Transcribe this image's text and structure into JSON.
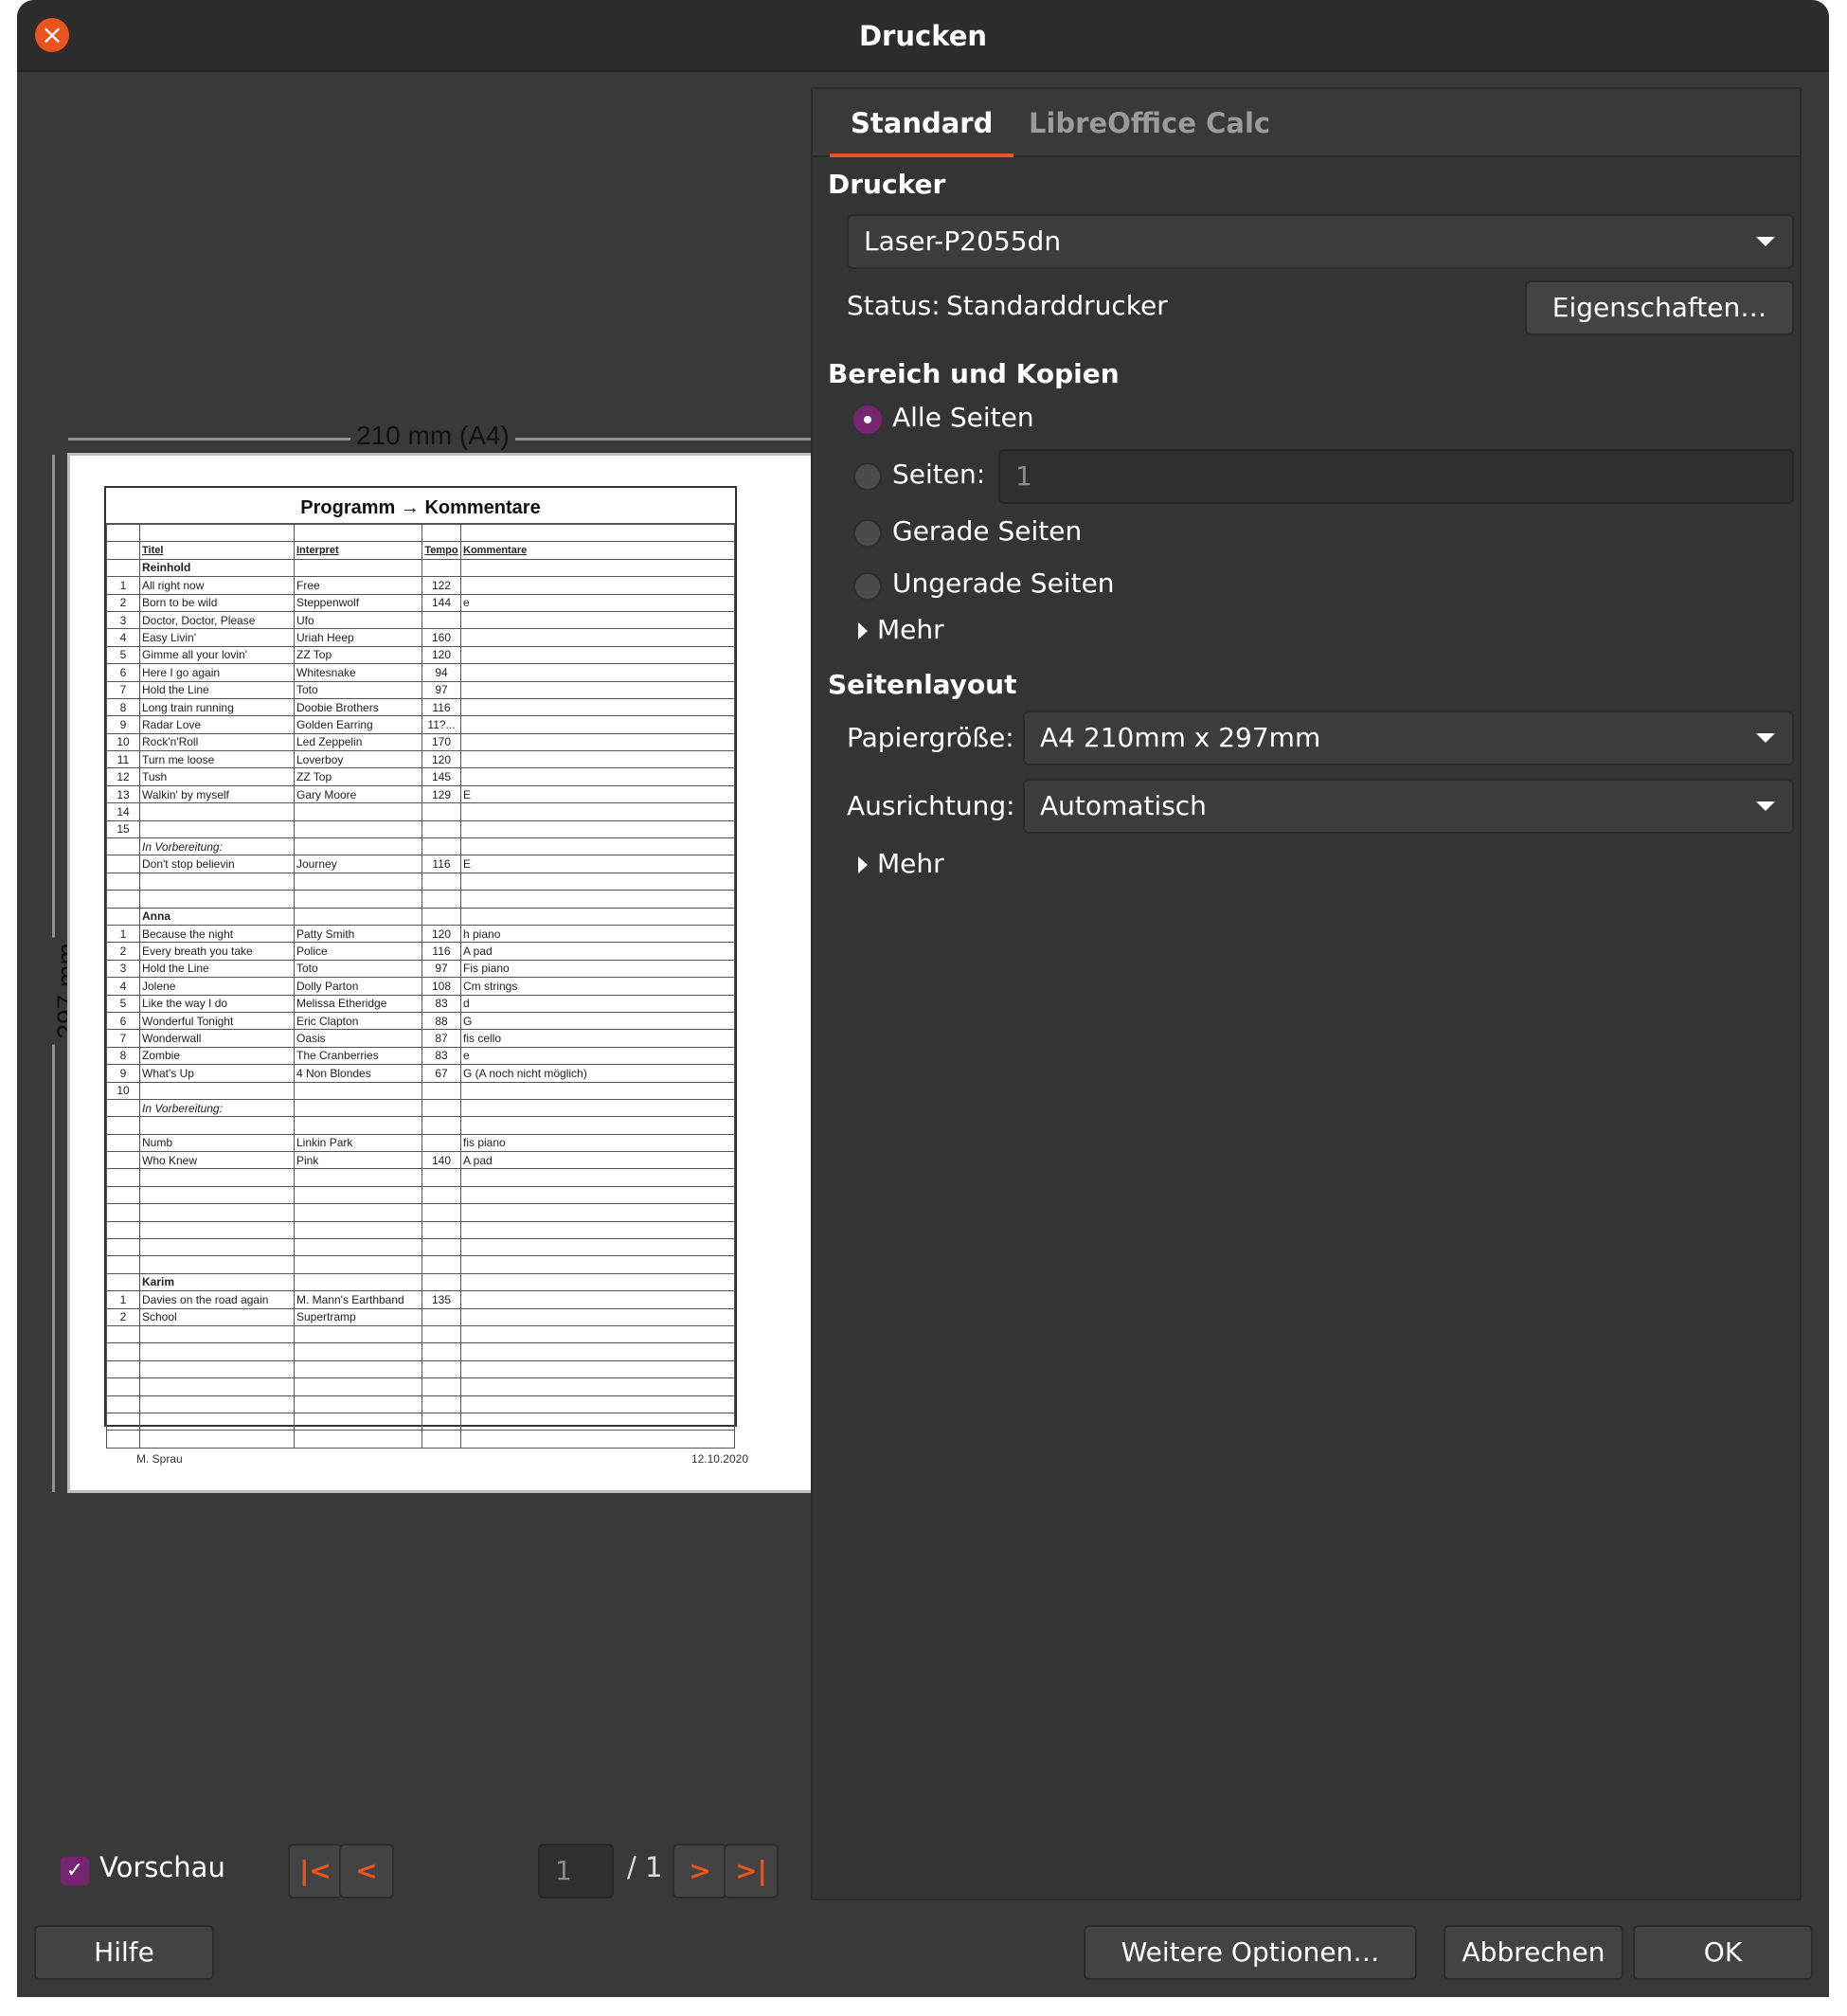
{
  "window": {
    "title": "Drucken"
  },
  "preview": {
    "ruler_width_label": "210 mm (A4)",
    "ruler_height_label": "297 mm",
    "sheet_title": "Programm → Kommentare",
    "footer_left": "M. Sprau",
    "footer_right": "12.10.2020",
    "rows": [
      [
        "",
        "",
        "",
        "",
        ""
      ],
      [
        "",
        "Titel",
        "Interpret",
        "Tempo",
        "Kommentare"
      ],
      [
        "",
        "Reinhold",
        "",
        "",
        ""
      ],
      [
        "1",
        "All right now",
        "Free",
        "122",
        ""
      ],
      [
        "2",
        "Born to be wild",
        "Steppenwolf",
        "144",
        "e"
      ],
      [
        "3",
        "Doctor, Doctor, Please",
        "Ufo",
        "",
        ""
      ],
      [
        "4",
        "Easy Livin'",
        "Uriah Heep",
        "160",
        ""
      ],
      [
        "5",
        "Gimme all your lovin'",
        "ZZ Top",
        "120",
        ""
      ],
      [
        "6",
        "Here I go again",
        "Whitesnake",
        "94",
        ""
      ],
      [
        "7",
        "Hold the Line",
        "Toto",
        "97",
        ""
      ],
      [
        "8",
        "Long train running",
        "Doobie Brothers",
        "116",
        ""
      ],
      [
        "9",
        "Radar Love",
        "Golden Earring",
        "11?...",
        ""
      ],
      [
        "10",
        "Rock'n'Roll",
        "Led Zeppelin",
        "170",
        ""
      ],
      [
        "11",
        "Turn me loose",
        "Loverboy",
        "120",
        ""
      ],
      [
        "12",
        "Tush",
        "ZZ Top",
        "145",
        ""
      ],
      [
        "13",
        "Walkin' by myself",
        "Gary Moore",
        "129",
        "E"
      ],
      [
        "14",
        "",
        "",
        "",
        ""
      ],
      [
        "15",
        "",
        "",
        "",
        ""
      ],
      [
        "",
        "In Vorbereitung:",
        "",
        "",
        ""
      ],
      [
        "",
        "Don't stop believin",
        "Journey",
        "116",
        "E"
      ],
      [
        "",
        "",
        "",
        "",
        ""
      ],
      [
        "",
        "",
        "",
        "",
        ""
      ],
      [
        "",
        "Anna",
        "",
        "",
        ""
      ],
      [
        "1",
        "Because the night",
        "Patty Smith",
        "120",
        "h piano"
      ],
      [
        "2",
        "Every breath you take",
        "Police",
        "116",
        "A pad"
      ],
      [
        "3",
        "Hold the Line",
        "Toto",
        "97",
        "Fis piano"
      ],
      [
        "4",
        "Jolene",
        "Dolly Parton",
        "108",
        "Cm strings"
      ],
      [
        "5",
        "Like the way I do",
        "Melissa Etheridge",
        "83",
        "d"
      ],
      [
        "6",
        "Wonderful Tonight",
        "Eric Clapton",
        "88",
        "G"
      ],
      [
        "7",
        "Wonderwall",
        "Oasis",
        "87",
        "fis cello"
      ],
      [
        "8",
        "Zombie",
        "The Cranberries",
        "83",
        "e"
      ],
      [
        "9",
        "What's Up",
        "4 Non Blondes",
        "67",
        "G (A noch nicht möglich)"
      ],
      [
        "10",
        "",
        "",
        "",
        ""
      ],
      [
        "",
        "In Vorbereitung:",
        "",
        "",
        ""
      ],
      [
        "",
        "",
        "",
        "",
        ""
      ],
      [
        "",
        "Numb",
        "Linkin Park",
        "",
        "fis piano"
      ],
      [
        "",
        "Who Knew",
        "Pink",
        "140",
        "A pad"
      ],
      [
        "",
        "",
        "",
        "",
        ""
      ],
      [
        "",
        "",
        "",
        "",
        ""
      ],
      [
        "",
        "",
        "",
        "",
        ""
      ],
      [
        "",
        "",
        "",
        "",
        ""
      ],
      [
        "",
        "",
        "",
        "",
        ""
      ],
      [
        "",
        "",
        "",
        "",
        ""
      ],
      [
        "",
        "Karim",
        "",
        "",
        ""
      ],
      [
        "1",
        "Davies on the road again",
        "M. Mann's Earthband",
        "135",
        ""
      ],
      [
        "2",
        "School",
        "Supertramp",
        "",
        ""
      ],
      [
        "",
        "",
        "",
        "",
        ""
      ],
      [
        "",
        "",
        "",
        "",
        ""
      ],
      [
        "",
        "",
        "",
        "",
        ""
      ],
      [
        "",
        "",
        "",
        "",
        ""
      ],
      [
        "",
        "",
        "",
        "",
        ""
      ],
      [
        "",
        "",
        "",
        "",
        ""
      ],
      [
        "",
        "",
        "",
        "",
        ""
      ]
    ],
    "checkbox_label": "Vorschau",
    "current_page": "1",
    "total_pages": "/ 1"
  },
  "tabs": [
    {
      "label": "Standard"
    },
    {
      "label": "LibreOffice Calc"
    }
  ],
  "printer": {
    "section": "Drucker",
    "selected": "Laser-P2055dn",
    "status_label": "Status:",
    "status_value": "Standarddrucker",
    "properties_button": "Eigenschaften…"
  },
  "range": {
    "section": "Bereich und Kopien",
    "all_pages": "Alle Seiten",
    "pages": "Seiten:",
    "pages_placeholder": "1",
    "even_pages": "Gerade Seiten",
    "odd_pages": "Ungerade Seiten",
    "more": "Mehr"
  },
  "layout": {
    "section": "Seitenlayout",
    "paper_label": "Papiergröße:",
    "paper_value": "A4 210mm x 297mm",
    "orientation_label": "Ausrichtung:",
    "orientation_value": "Automatisch",
    "more": "Mehr"
  },
  "buttons": {
    "help": "Hilfe",
    "more_options": "Weitere Optionen…",
    "cancel": "Abbrechen",
    "ok": "OK"
  },
  "colors": {
    "accent": "#e95420",
    "selection": "#762572"
  },
  "icons": {
    "first": "first-page-icon",
    "prev": "previous-page-icon",
    "next": "next-page-icon",
    "last": "last-page-icon",
    "close": "close-icon"
  }
}
